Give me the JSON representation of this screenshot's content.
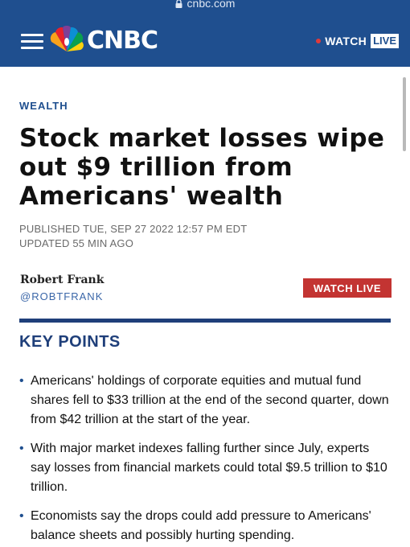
{
  "browser": {
    "url": "cnbc.com"
  },
  "header": {
    "brand": "CNBC",
    "watch_label": "WATCH",
    "live_label": "LIVE"
  },
  "article": {
    "section": "WEALTH",
    "headline": "Stock market losses wipe out $9 trillion from Americans' wealth",
    "published": "PUBLISHED TUE, SEP 27 2022 12:57 PM EDT",
    "updated": "UPDATED 55 MIN AGO",
    "author": "Robert Frank",
    "handle": "@ROBTFRANK",
    "watch_live_button": "WATCH LIVE"
  },
  "key_points": {
    "title": "KEY POINTS",
    "items": [
      "Americans' holdings of corporate equities and mutual fund shares fell to $33 trillion at the end of the second quarter, down from $42 trillion at the start of the year.",
      "With major market indexes falling further since July, experts say losses from financial markets could total $9.5 trillion to $10 trillion.",
      "Economists say the drops could add pressure to Americans' balance sheets and possibly hurting spending."
    ]
  },
  "colors": {
    "header_bg": "#1f4f8f",
    "accent_red": "#c33432",
    "divider_navy": "#1f3f7a"
  },
  "icons": {
    "lock": "lock-icon",
    "menu": "menu-icon",
    "logo": "peacock-icon",
    "live_indicator": "live-dot"
  }
}
